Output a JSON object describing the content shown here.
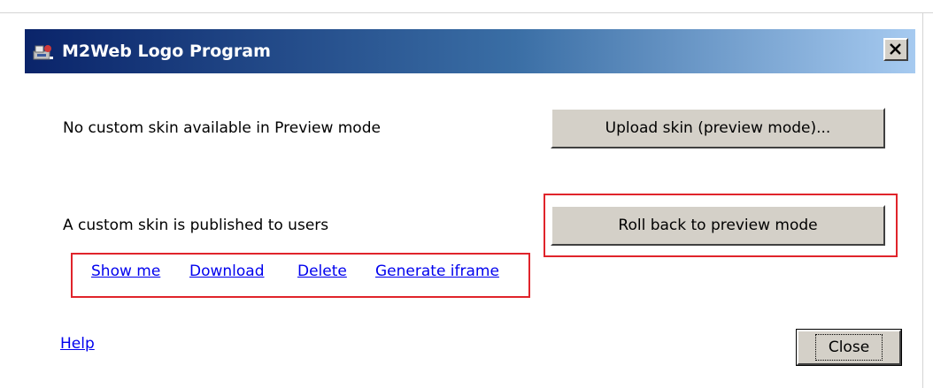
{
  "window": {
    "title": "M2Web Logo Program",
    "close_glyph": "✕",
    "titlebar_color_start": "#0a246a",
    "titlebar_color_end": "#a6caf0"
  },
  "preview": {
    "status_text": "No custom skin available in Preview mode",
    "upload_button_label": "Upload skin (preview mode)..."
  },
  "published": {
    "status_text": "A custom skin is published to users",
    "rollback_button_label": "Roll back to preview mode",
    "links": {
      "show_me": "Show me",
      "download": "Download",
      "delete": "Delete",
      "generate_iframe": "Generate iframe"
    }
  },
  "footer": {
    "help_link": "Help",
    "close_button_label": "Close"
  },
  "colors": {
    "highlight": "#e0242b",
    "link": "#0000ee",
    "button_face": "#d4d0c8"
  }
}
